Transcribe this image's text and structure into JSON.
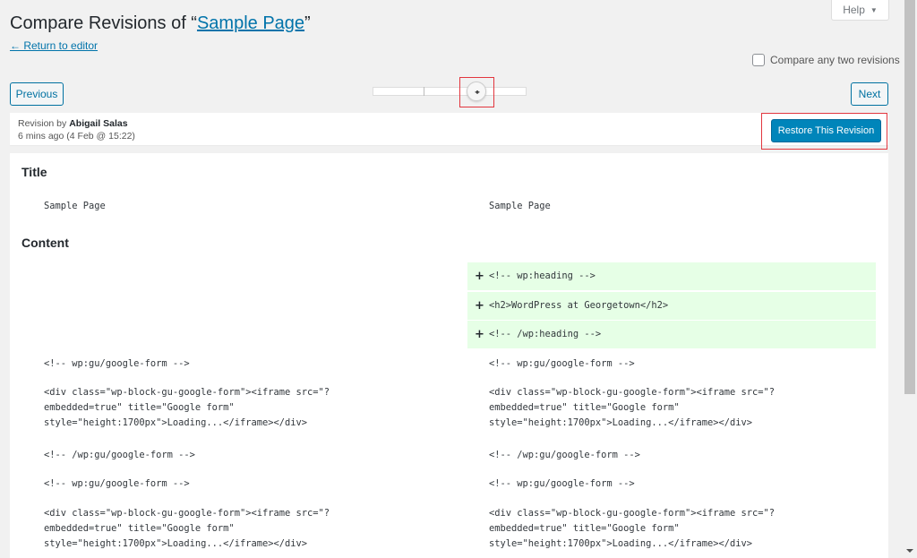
{
  "header": {
    "title_prefix": "Compare Revisions of “",
    "title_link": "Sample Page",
    "title_suffix": "”",
    "return_link": "← Return to editor",
    "help_label": "Help",
    "help_caret": "▼"
  },
  "controls": {
    "compare_two_label": "Compare any two revisions",
    "compare_two_checked": false,
    "previous_label": "Previous",
    "next_label": "Next",
    "slider_handle_icon": "◂▸"
  },
  "revision": {
    "by_prefix": "Revision by ",
    "author": "Abigail Salas",
    "time_ago": "6 mins ago",
    "date": "(4 Feb @ 15:22)",
    "restore_label": "Restore This Revision"
  },
  "diff": {
    "title_heading": "Title",
    "title_left": "Sample Page",
    "title_right": "Sample Page",
    "content_heading": "Content",
    "added_lines": [
      "<!-- wp:heading -->",
      "<h2>WordPress at Georgetown</h2>",
      "<!-- /wp:heading -->"
    ],
    "context_lines": [
      "<!-- wp:gu/google-form -->",
      "<div class=\"wp-block-gu-google-form\"><iframe src=\"?\nembedded=true\" title=\"Google form\"\nstyle=\"height:1700px\">Loading...</iframe></div>",
      "<!-- /wp:gu/google-form -->",
      "<!-- wp:gu/google-form -->",
      "<div class=\"wp-block-gu-google-form\"><iframe src=\"?\nembedded=true\" title=\"Google form\"\nstyle=\"height:1700px\">Loading...</iframe></div>"
    ],
    "plus_sign": "+"
  },
  "colors": {
    "accent": "#0073aa",
    "primary_button": "#0085ba",
    "added_bg": "#e6ffe6",
    "annotation": "#e2363e"
  }
}
